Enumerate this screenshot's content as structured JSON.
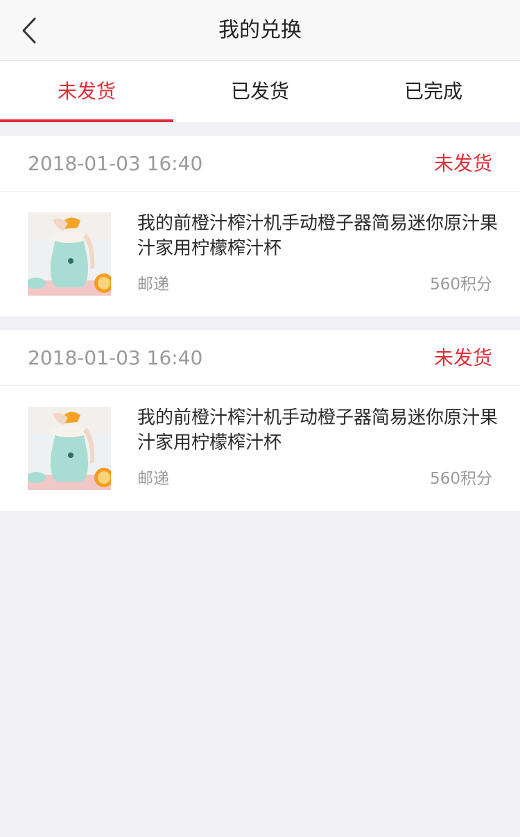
{
  "header": {
    "title": "我的兑换",
    "back_icon": "chevron-left-icon"
  },
  "tabs": [
    {
      "label": "未发货",
      "active": true
    },
    {
      "label": "已发货",
      "active": false
    },
    {
      "label": "已完成",
      "active": false
    }
  ],
  "colors": {
    "accent": "#e02e38",
    "page_bg": "#f2f2f6",
    "muted_text": "#9a9a9a"
  },
  "orders": [
    {
      "date": "2018-01-03 16:40",
      "status": "未发货",
      "item": {
        "title": "我的前橙汁榨汁机手动橙子器简易迷你原汁果汁家用柠檬榨汁杯",
        "image": "juicer-product-image",
        "shipping": "邮递",
        "points": "560积分"
      }
    },
    {
      "date": "2018-01-03 16:40",
      "status": "未发货",
      "item": {
        "title": "我的前橙汁榨汁机手动橙子器简易迷你原汁果汁家用柠檬榨汁杯",
        "image": "juicer-product-image",
        "shipping": "邮递",
        "points": "560积分"
      }
    }
  ]
}
